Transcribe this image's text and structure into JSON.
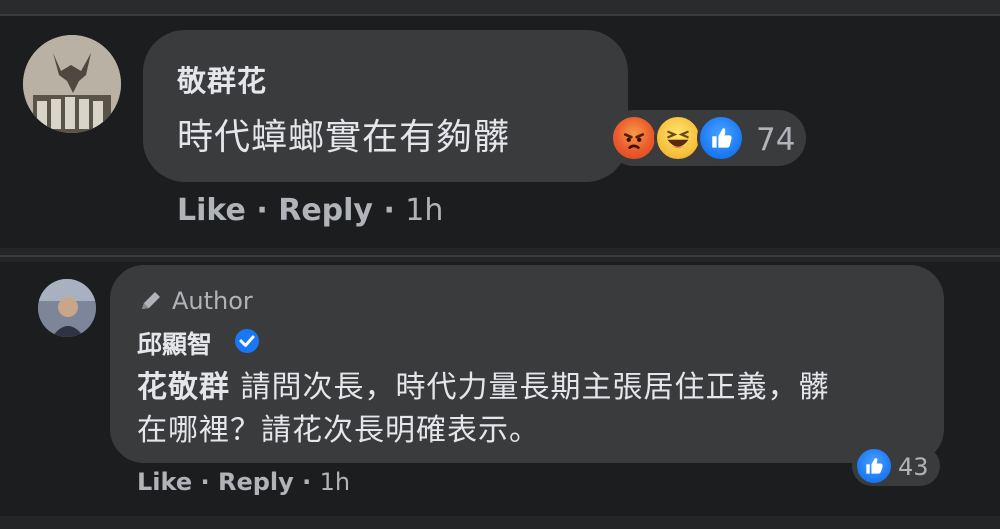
{
  "comment": {
    "author": "敬群花",
    "text": "時代蟑螂實在有夠髒",
    "reaction_count": "74",
    "reactions": [
      "angry-icon",
      "haha-icon",
      "like-icon"
    ],
    "actions": {
      "like": "Like",
      "reply": "Reply",
      "time": "1h",
      "separator": "·"
    }
  },
  "reply": {
    "badge": "Author",
    "author": "邱顯智",
    "verified": true,
    "mention": "花敬群",
    "text_line1": "請問次長，時代力量長期主張居住正義，髒",
    "text_line2": "在哪裡？請花次長明確表示。",
    "reaction_count": "43",
    "reactions": [
      "like-icon"
    ],
    "actions": {
      "like": "Like",
      "reply": "Reply",
      "time": "1h",
      "separator": "·"
    }
  },
  "colors": {
    "background": "#1c1d1f",
    "bubble": "#3a3b3c",
    "text_primary": "#e4e6eb",
    "text_secondary": "#b0b3b8",
    "like_blue": "#1877f2",
    "angry_orange": "#ea5a2c",
    "haha_yellow": "#f7c23f"
  }
}
